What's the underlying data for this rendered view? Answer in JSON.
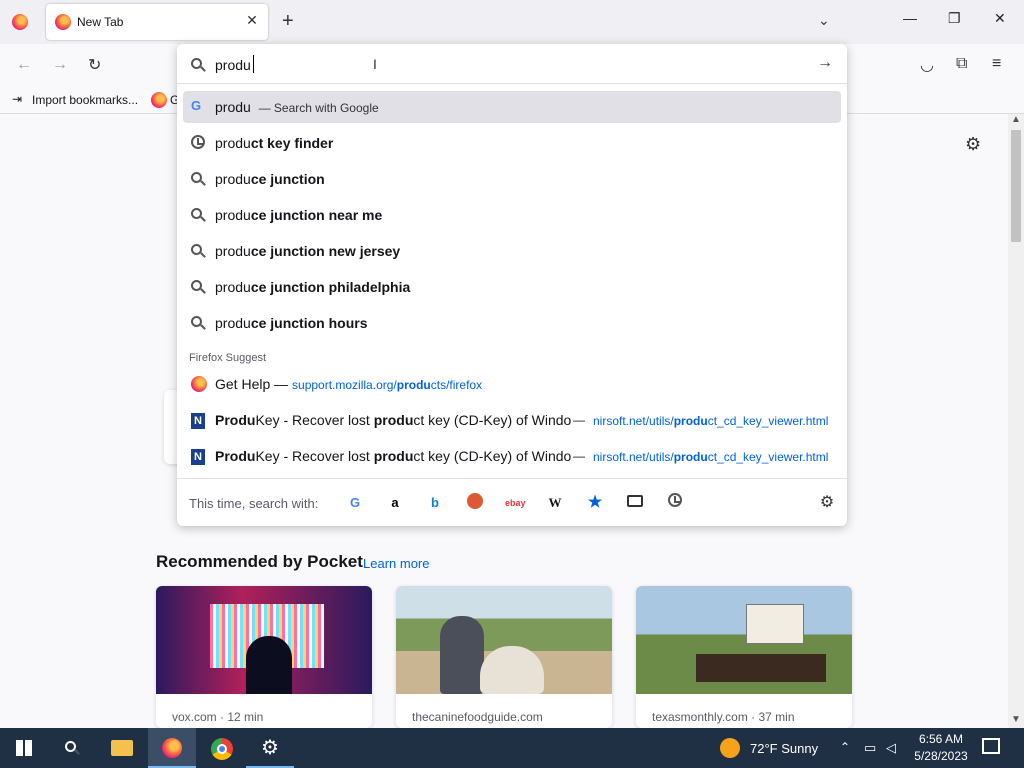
{
  "browser": {
    "tab_title": "New Tab",
    "new_tab_symbol": "+",
    "bookmark_import": "Import bookmarks...",
    "bookmark_second": "G"
  },
  "urlbar": {
    "value": "produ",
    "first_row": {
      "text": "produ",
      "action": "— Search with Google"
    },
    "suggestions": [
      {
        "typed": "produ",
        "rest": "ct key finder",
        "icon": "history-icon"
      },
      {
        "typed": "produ",
        "rest": "ce junction",
        "icon": "search-icon"
      },
      {
        "typed": "produ",
        "rest": "ce junction near me",
        "icon": "search-icon"
      },
      {
        "typed": "produ",
        "rest": "ce junction new jersey",
        "icon": "search-icon"
      },
      {
        "typed": "produ",
        "rest": "ce junction philadelphia",
        "icon": "search-icon"
      },
      {
        "typed": "produ",
        "rest": "ce junction hours",
        "icon": "search-icon"
      }
    ],
    "suggest_header": "Firefox Suggest",
    "get_help": {
      "label": "Get Help",
      "sep": "—",
      "url_pre": "support.mozilla.org/",
      "url_bold": "produ",
      "url_post": "cts/firefox"
    },
    "produkey": [
      {
        "b1": "Produ",
        "t1": "Key - Recover lost ",
        "b2": "produ",
        "t2": "ct key (CD-Key) of Windo",
        "url_pre": "nirsoft.net/utils/",
        "url_bold": "produ",
        "url_post": "ct_cd_key_viewer.html"
      },
      {
        "b1": "Produ",
        "t1": "Key - Recover lost ",
        "b2": "produ",
        "t2": "ct key (CD-Key) of Windo",
        "url_pre": "nirsoft.net/utils/",
        "url_bold": "produ",
        "url_post": "ct_cd_key_viewer.html"
      }
    ],
    "search_with": "This time, search with:"
  },
  "pocket": {
    "title": "Recommended by Pocket",
    "learn_more": "Learn more",
    "cards": [
      {
        "source": "vox.com · 12 min"
      },
      {
        "source": "thecaninefoodguide.com"
      },
      {
        "source": "texasmonthly.com · 37 min"
      }
    ]
  },
  "taskbar": {
    "weather": "72°F  Sunny",
    "time": "6:56 AM",
    "date": "5/28/2023"
  }
}
